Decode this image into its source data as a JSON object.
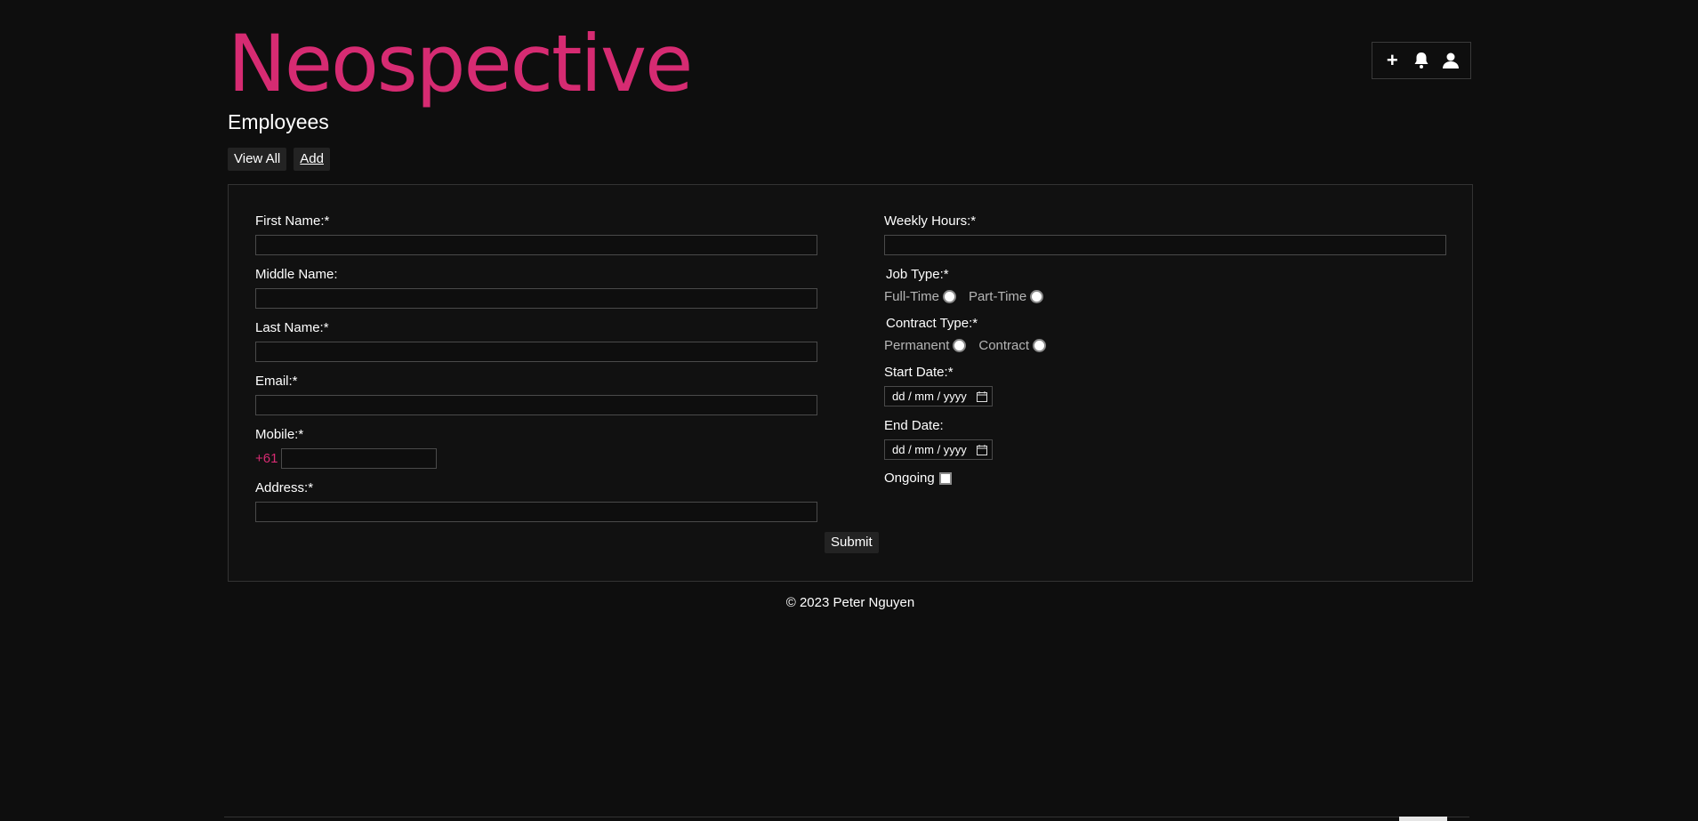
{
  "brand": {
    "name": "Neospective",
    "color": "#d62b72"
  },
  "page": {
    "title": "Employees"
  },
  "subnav": {
    "view_all": "View All",
    "add": "Add"
  },
  "top_actions": {
    "add_icon": "+",
    "notifications_icon": "bell-icon",
    "profile_icon": "user-icon"
  },
  "form": {
    "first_name": {
      "label": "First Name:*",
      "value": ""
    },
    "middle_name": {
      "label": "Middle Name:",
      "value": ""
    },
    "last_name": {
      "label": "Last Name:*",
      "value": ""
    },
    "email": {
      "label": "Email:*",
      "value": ""
    },
    "mobile": {
      "label": "Mobile:*",
      "prefix": "+61",
      "value": ""
    },
    "address": {
      "label": "Address:*",
      "value": ""
    },
    "weekly_hours": {
      "label": "Weekly Hours:*",
      "value": ""
    },
    "job_type": {
      "label": "Job Type:*",
      "options": [
        "Full-Time",
        "Part-Time"
      ]
    },
    "contract_type": {
      "label": "Contract Type:*",
      "options": [
        "Permanent",
        "Contract"
      ]
    },
    "start_date": {
      "label": "Start Date:*",
      "placeholder": "dd / mm / yyyy"
    },
    "end_date": {
      "label": "End Date:",
      "placeholder": "dd / mm / yyyy"
    },
    "ongoing": {
      "label": "Ongoing",
      "checked": false
    },
    "submit_label": "Submit"
  },
  "footer": {
    "text": "© 2023 Peter Nguyen"
  }
}
